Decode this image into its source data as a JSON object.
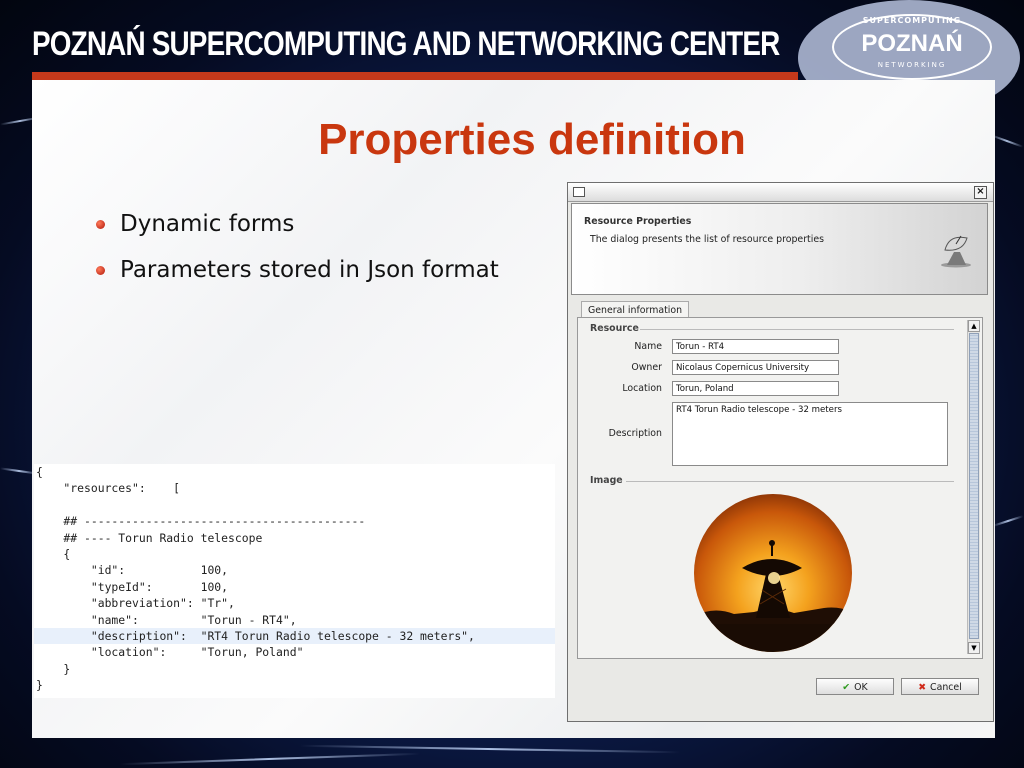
{
  "banner": {
    "title": "POZNAŃ SUPERCOMPUTING AND NETWORKING CENTER",
    "logo_top": "SUPERCOMPUTING",
    "logo_main": "POZNAŃ",
    "logo_bottom": "NETWORKING"
  },
  "slide": {
    "title": "Properties definition",
    "bullets": [
      "Dynamic forms",
      "Parameters stored in Json format"
    ]
  },
  "code": {
    "lines": [
      "{",
      "    \"resources\":    [",
      "",
      "    ## -----------------------------------------",
      "    ## ---- Torun Radio telescope",
      "    {",
      "        \"id\":           100,",
      "        \"typeId\":       100,",
      "        \"abbreviation\": \"Tr\",",
      "        \"name\":         \"Torun - RT4\",",
      "        \"description\":  \"RT4 Torun Radio telescope - 32 meters\",",
      "        \"location\":     \"Torun, Poland\"",
      "    }",
      "}"
    ]
  },
  "dialog": {
    "header_title": "Resource Properties",
    "header_desc": "The dialog presents the list of resource properties",
    "tab_label": "General information",
    "section_resource": "Resource",
    "section_image": "Image",
    "fields": {
      "name_label": "Name",
      "name_value": "Torun - RT4",
      "owner_label": "Owner",
      "owner_value": "Nicolaus Copernicus University",
      "location_label": "Location",
      "location_value": "Torun, Poland",
      "description_label": "Description",
      "description_value": "RT4 Torun Radio telescope - 32 meters"
    },
    "ok_label": "OK",
    "cancel_label": "Cancel",
    "close_glyph": "×"
  },
  "colors": {
    "title_red": "#c9370f",
    "banner_bar": "#c5391b",
    "ok_check": "#2e9a1e",
    "cancel_x": "#d02a1a"
  }
}
